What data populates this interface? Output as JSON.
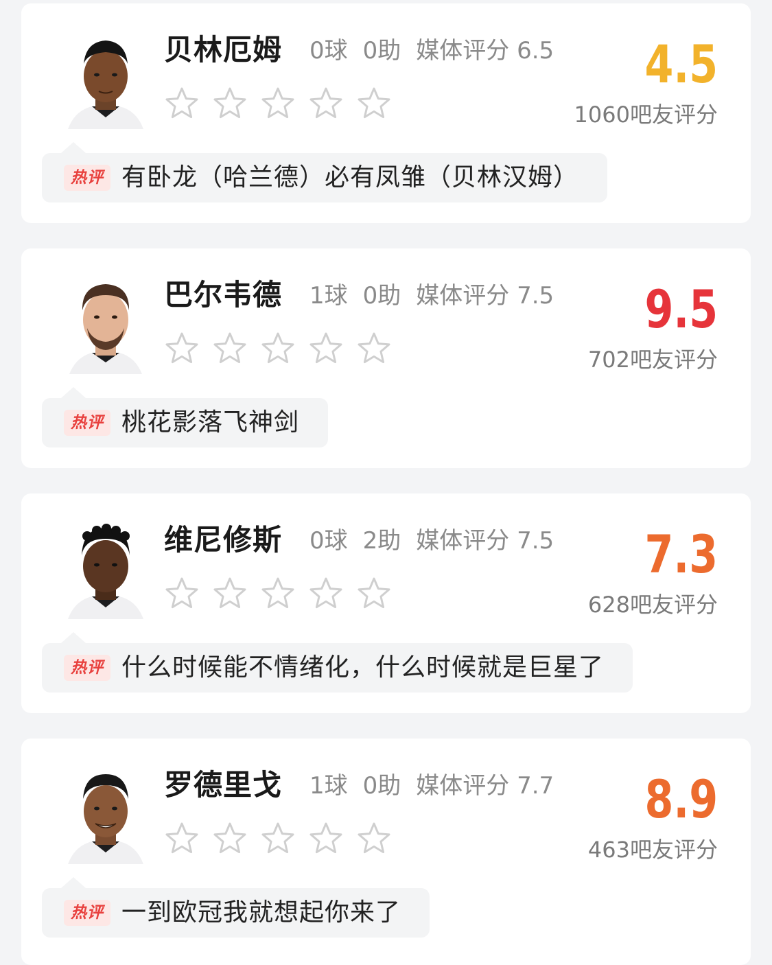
{
  "accent_colors": {
    "score_yellow": "#f2b22b",
    "score_red": "#e6343a",
    "score_orange": "#ec6b2e",
    "hot_badge": "#e8413e"
  },
  "hot_label": "热评",
  "stats_labels": {
    "rating_prefix": "媒体评分",
    "votes_suffix": "吧友评分"
  },
  "players": [
    {
      "name": "贝林厄姆",
      "goals": "0球",
      "assists": "0助",
      "media_rating": "媒体评分 6.5",
      "score": "4.5",
      "score_color": "#f2b22b",
      "votes": "1060吧友评分",
      "stars_filled": 0,
      "comment": "有卧龙（哈兰德）必有凤雏（贝林汉姆）"
    },
    {
      "name": "巴尔韦德",
      "goals": "1球",
      "assists": "0助",
      "media_rating": "媒体评分 7.5",
      "score": "9.5",
      "score_color": "#e6343a",
      "votes": "702吧友评分",
      "stars_filled": 0,
      "comment": "桃花影落飞神剑"
    },
    {
      "name": "维尼修斯",
      "goals": "0球",
      "assists": "2助",
      "media_rating": "媒体评分 7.5",
      "score": "7.3",
      "score_color": "#ec6b2e",
      "votes": "628吧友评分",
      "stars_filled": 0,
      "comment": "什么时候能不情绪化，什么时候就是巨星了"
    },
    {
      "name": "罗德里戈",
      "goals": "1球",
      "assists": "0助",
      "media_rating": "媒体评分 7.7",
      "score": "8.9",
      "score_color": "#ec6b2e",
      "votes": "463吧友评分",
      "stars_filled": 0,
      "comment": "一到欧冠我就想起你来了"
    }
  ]
}
